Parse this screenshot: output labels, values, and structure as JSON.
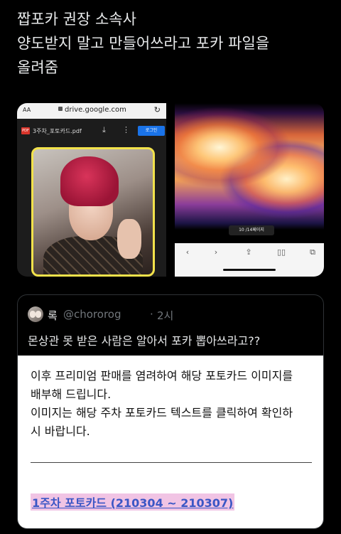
{
  "tweet": {
    "lines": [
      "짭포카 권장 소속사",
      "양도받지 말고 만들어쓰라고 포카 파일을",
      "올려줌"
    ]
  },
  "screenshot_left": {
    "aa_label": "AA",
    "url": "drive.google.com",
    "reload_icon": "reload-icon",
    "pdf_badge": "PDF",
    "file_name": "3주차_포토카드.pdf",
    "login_label": "로그인",
    "colors": {
      "card_border": "#f2e24b",
      "hair": "#c8244a",
      "login_button": "#1a73e8"
    }
  },
  "screenshot_right": {
    "page_indicator": "10 /14페이지",
    "toolbar_icons": [
      "back-icon",
      "forward-icon",
      "share-icon",
      "bookmarks-icon",
      "tabs-icon"
    ]
  },
  "quote": {
    "name": "록",
    "handle": "@chororog",
    "dot": "·",
    "time": "2시",
    "text": "몬상관 못 받은 사람은 알아서 포카 뽑아쓰라고??",
    "notice_lines": [
      "이후 프리미엄 판매를 염려하여 해당 포토카드 이미지를",
      "배부해 드립니다.",
      "이미지는 해당 주차 포토카드 텍스트를 클릭하여 확인하",
      "시 바랍니다."
    ],
    "link_text": "1주차 포토카드 (210304 ~ 210307)",
    "colors": {
      "link": "#3a56c5",
      "link_highlight": "#f1c4e4"
    }
  }
}
